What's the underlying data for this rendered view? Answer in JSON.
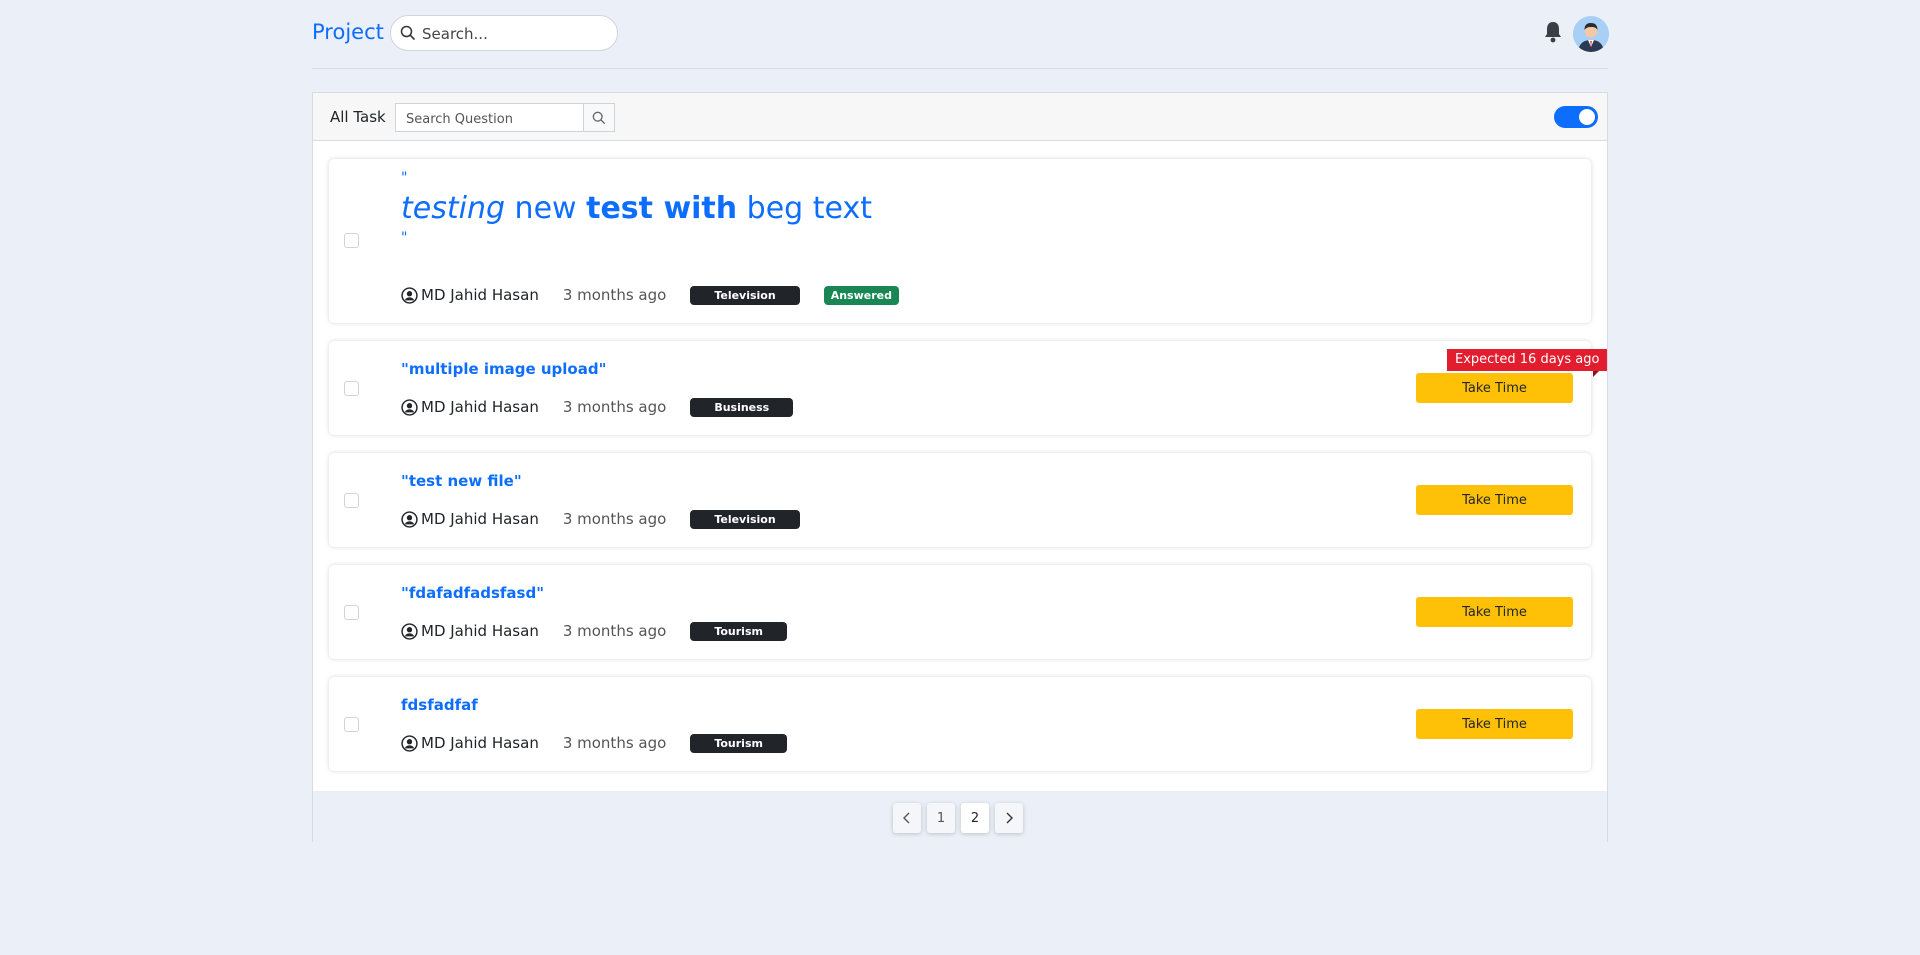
{
  "header": {
    "brand": "Project",
    "search_placeholder": "Search..."
  },
  "panel": {
    "title": "All Task",
    "search_placeholder": "Search Question",
    "toggle_on": true
  },
  "tasks": [
    {
      "title_parts": [
        {
          "text": "testing",
          "style": "italic"
        },
        {
          "text": " new ",
          "style": "normal"
        },
        {
          "text": "test with",
          "style": "bold"
        },
        {
          "text": " beg text",
          "style": "normal"
        }
      ],
      "quote_open": "\"",
      "quote_close": "\"",
      "author": "MD Jahid Hasan",
      "time": "3 months ago",
      "tag": "Television",
      "status": "Answered"
    },
    {
      "title": "\"multiple image upload\"",
      "author": "MD Jahid Hasan",
      "time": "3 months ago",
      "tag": "Business",
      "ribbon": "Expected 16 days ago",
      "action": "Take Time"
    },
    {
      "title": "\"test new file\"",
      "author": "MD Jahid Hasan",
      "time": "3 months ago",
      "tag": "Television",
      "action": "Take Time"
    },
    {
      "title": "\"fdafadfadsfasd\"",
      "author": "MD Jahid Hasan",
      "time": "3 months ago",
      "tag": "Tourism",
      "action": "Take Time"
    },
    {
      "title": "fdsfadfaf",
      "author": "MD Jahid Hasan",
      "time": "3 months ago",
      "tag": "Tourism",
      "action": "Take Time"
    }
  ],
  "pagination": {
    "pages": [
      "1",
      "2"
    ],
    "current": "2"
  },
  "colors": {
    "accent": "#0d6efd",
    "take_time": "#ffc107",
    "ribbon": "#e11d2e",
    "answered": "#198754",
    "tag": "#212529"
  }
}
